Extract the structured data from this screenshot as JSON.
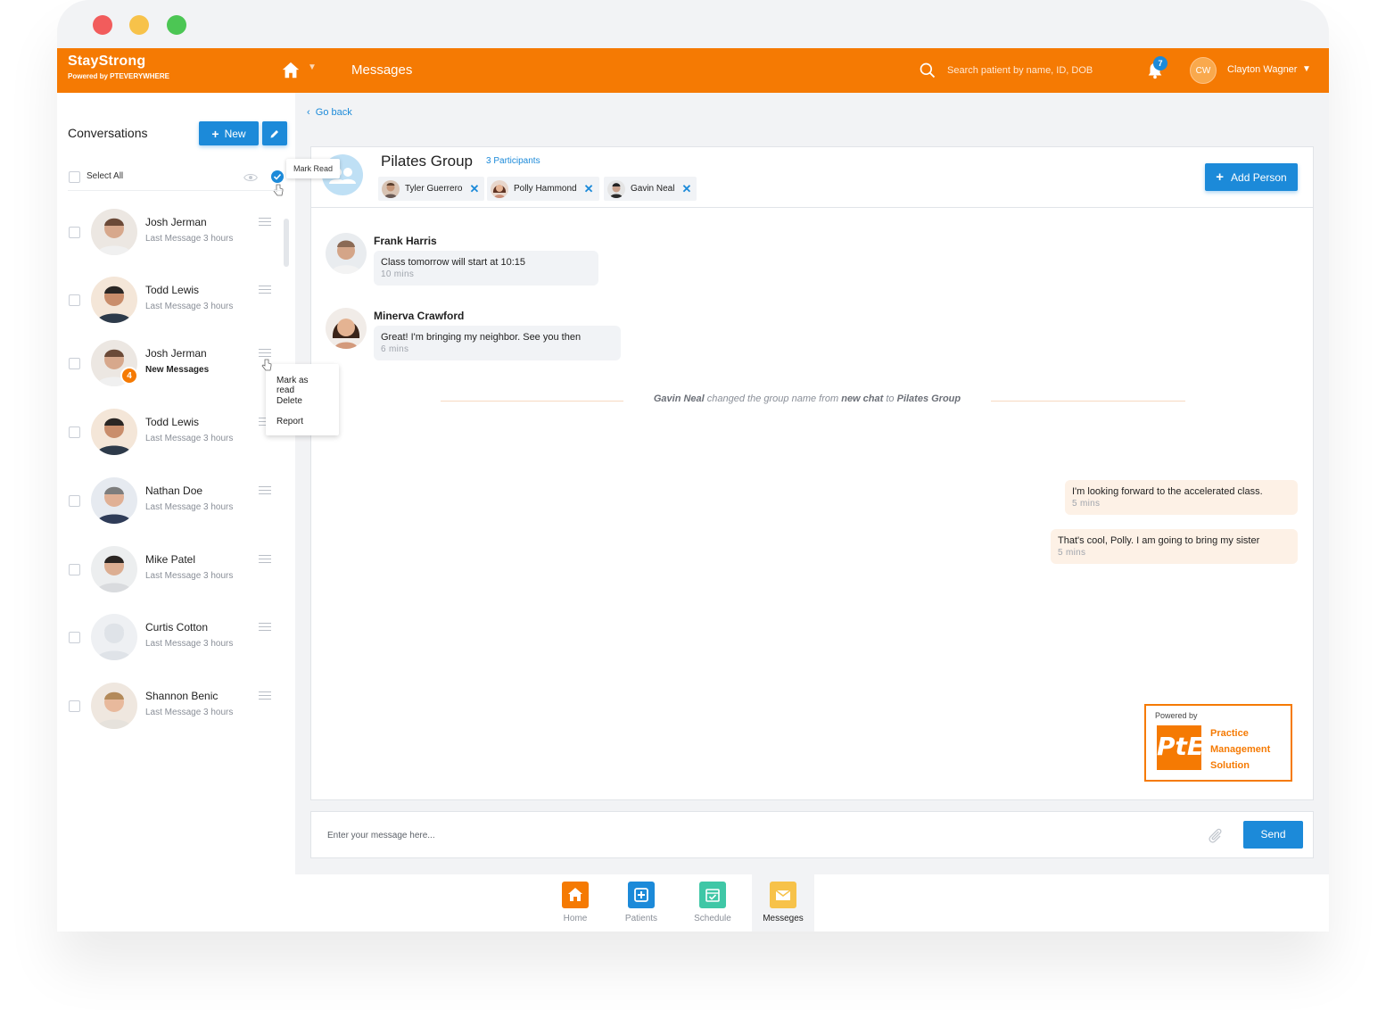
{
  "app": {
    "brand_name": "StayStrong",
    "brand_sub": "Powered by PTEVERYWHERE",
    "nav_title": "Messages",
    "search_placeholder": "Search patient by name, ID, DOB",
    "notification_count": "7",
    "user_initials": "CW",
    "user_name": "Clayton Wagner",
    "accent_color": "#f57a03",
    "primary_color": "#1c8ad9"
  },
  "sidebar": {
    "title": "Conversations",
    "new_label": "New",
    "select_all_label": "Select All",
    "mark_read_tooltip": "Mark Read",
    "conversations": [
      {
        "name": "Josh Jerman",
        "sub": "Last Message 3 hours",
        "unread": false
      },
      {
        "name": "Todd Lewis",
        "sub": "Last Message 3 hours",
        "unread": false
      },
      {
        "name": "Josh Jerman",
        "sub": "New Messages",
        "unread": true,
        "badge": "4"
      },
      {
        "name": "Todd Lewis",
        "sub": "Last Message 3 hours",
        "unread": false
      },
      {
        "name": "Nathan Doe",
        "sub": "Last Message 3 hours",
        "unread": false
      },
      {
        "name": "Mike Patel",
        "sub": "Last Message 3 hours",
        "unread": false
      },
      {
        "name": "Curtis Cotton",
        "sub": "Last Message 3 hours",
        "unread": false
      },
      {
        "name": "Shannon Benic",
        "sub": "Last Message 3 hours",
        "unread": false
      }
    ],
    "context_menu": [
      "Mark as read",
      "Delete",
      "Report"
    ]
  },
  "chat": {
    "go_back": "Go back",
    "group_title": "Pilates Group",
    "participants_link": "3 Participants",
    "participants": [
      "Tyler Guerrero",
      "Polly Hammond",
      "Gavin Neal"
    ],
    "add_person_label": "Add Person",
    "messages": [
      {
        "author": "Frank Harris",
        "text": "Class tomorrow will start at 10:15",
        "time": "10 mins"
      },
      {
        "author": "Minerva Crawford",
        "text": "Great!  I'm bringing my neighbor.  See you then",
        "time": "6 mins"
      }
    ],
    "system": {
      "actor": "Gavin Neal",
      "middle": "changed the group name from",
      "old_name": "new chat",
      "to": "to",
      "new_name": "Pilates Group"
    },
    "outgoing": [
      {
        "text": "I'm looking forward to the accelerated class.",
        "time": "5 mins"
      },
      {
        "text": "That's cool, Polly.  I am going to bring my sister",
        "time": "5 mins"
      }
    ],
    "pte_logo": {
      "powered_by": "Powered by",
      "mark": "PtE",
      "line1": "Practice",
      "line2": "Management",
      "line3": "Solution"
    },
    "composer_placeholder": "Enter your message here...",
    "send_label": "Send"
  },
  "bottom_nav": {
    "tabs": [
      {
        "label": "Home",
        "color": "#f57a03"
      },
      {
        "label": "Patients",
        "color": "#1c8ad9"
      },
      {
        "label": "Schedule",
        "color": "#3fc7a6"
      },
      {
        "label": "Messeges",
        "color": "#f7c24a"
      }
    ],
    "active": "Messeges"
  }
}
